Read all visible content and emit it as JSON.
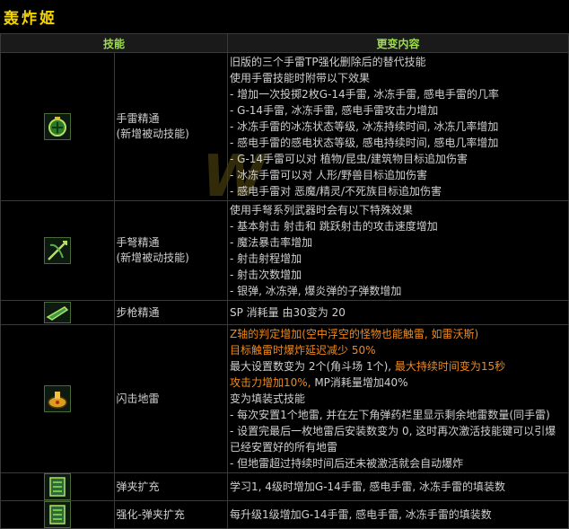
{
  "title": "轰炸姬",
  "table": {
    "header_skill": "技能",
    "header_change": "更变内容",
    "rows": [
      {
        "name": "手雷精通",
        "sub": "(新增被动技能)",
        "lines": [
          "旧版的三个手雷TP强化删除后的替代技能",
          "使用手雷技能时附带以下效果",
          "- 增加一次投掷2枚G-14手雷, 冰冻手雷, 感电手雷的几率",
          "- G-14手雷, 冰冻手雷, 感电手雷攻击力增加",
          "- 冰冻手雷的冰冻状态等级, 冰冻持续时间, 冰冻几率增加",
          "- 感电手雷的感电状态等级, 感电持续时间, 感电几率增加",
          "- G-14手雷可以对 植物/昆虫/建筑物目标追加伤害",
          "- 冰冻手雷可以对 人形/野兽目标追加伤害",
          "- 感电手雷对 恶魔/精灵/不死族目标追加伤害"
        ]
      },
      {
        "name": "手弩精通",
        "sub": "(新增被动技能)",
        "lines": [
          "使用手弩系列武器时会有以下特殊效果",
          "- 基本射击 射击和 跳跃射击的攻击速度增加",
          "- 魔法暴击率增加",
          "- 射击射程增加",
          "- 射击次数增加",
          "- 银弹, 冰冻弹, 爆炎弹的子弹数增加"
        ]
      },
      {
        "name": "步枪精通",
        "lines": [
          "SP 消耗量 由30变为 20"
        ]
      },
      {
        "name": "闪击地雷",
        "lines": [
          "Z轴的判定增加(空中浮空的怪物也能触雷, 如雷沃斯)",
          "目标触雷时爆炸延迟减少 50%",
          "最大设置数变为 2个(角斗场 1个), ",
          "最大持续时间变为15秒",
          "攻击力增加10%, ",
          "MP消耗量增加40%",
          "变为填装式技能",
          "- 每次安置1个地雷, 并在左下角弹药栏里显示剩余地雷数量(同手雷)",
          "- 设置完最后一枚地雷后安装数变为 0, 这时再次激活技能键可以引爆已经安置好的所有地雷",
          "- 但地雷超过持续时间后还未被激活就会自动爆炸"
        ]
      },
      {
        "name": "弹夹扩充",
        "lines": [
          "学习1, 4级时增加G-14手雷, 感电手雷, 冰冻手雷的填装数"
        ]
      },
      {
        "name": "强化-弹夹扩充",
        "lines": [
          "每升级1级增加G-14手雷, 感电手雷, 冰冻手雷的填装数"
        ]
      }
    ]
  },
  "icons": [
    "grenade-icon",
    "crossbow-icon",
    "rifle-icon",
    "mine-icon",
    "magazine-icon",
    "magazine-icon"
  ]
}
